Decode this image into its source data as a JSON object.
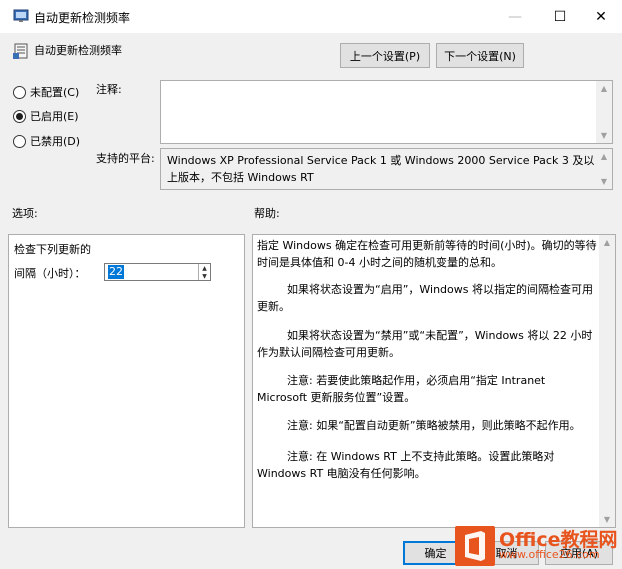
{
  "window": {
    "title": "自动更新检测频率",
    "controls": {
      "minimize": "—",
      "maximize": "☐",
      "close": "✕"
    }
  },
  "header": {
    "policy_name": "自动更新检测频率",
    "prev_button": "上一个设置(P)",
    "next_button": "下一个设置(N)"
  },
  "state": {
    "options": [
      {
        "label": "未配置(C)",
        "selected": false
      },
      {
        "label": "已启用(E)",
        "selected": true
      },
      {
        "label": "已禁用(D)",
        "selected": false
      }
    ]
  },
  "comment": {
    "label": "注释:",
    "value": ""
  },
  "platform": {
    "label": "支持的平台:",
    "value": "Windows XP Professional Service Pack 1 或 Windows 2000 Service Pack 3 及以上版本，不包括 Windows RT"
  },
  "options_section": {
    "label": "选项:",
    "heading": "检查下列更新的",
    "interval_label": "间隔（小时）：",
    "interval_value": "22"
  },
  "help_section": {
    "label": "帮助:",
    "paragraphs": [
      "指定 Windows 确定在检查可用更新前等待的时间(小时)。确切的等待时间是具体值和 0-4 小时之间的随机变量的总和。",
      "如果将状态设置为“启用”，Windows 将以指定的间隔检查可用更新。",
      "如果将状态设置为“禁用”或“未配置”，Windows 将以 22 小时作为默认间隔检查可用更新。",
      "注意: 若要使此策略起作用，必须启用“指定 Intranet Microsoft 更新服务位置”设置。",
      "注意: 如果“配置自动更新”策略被禁用，则此策略不起作用。",
      "注意: 在 Windows RT 上不支持此策略。设置此策略对 Windows RT 电脑没有任何影响。"
    ]
  },
  "footer": {
    "ok_button": "确定",
    "cancel_button": "取消",
    "apply_button": "应用(A)"
  },
  "watermark": {
    "main": "Office教程网",
    "url": "www.office26.com"
  }
}
